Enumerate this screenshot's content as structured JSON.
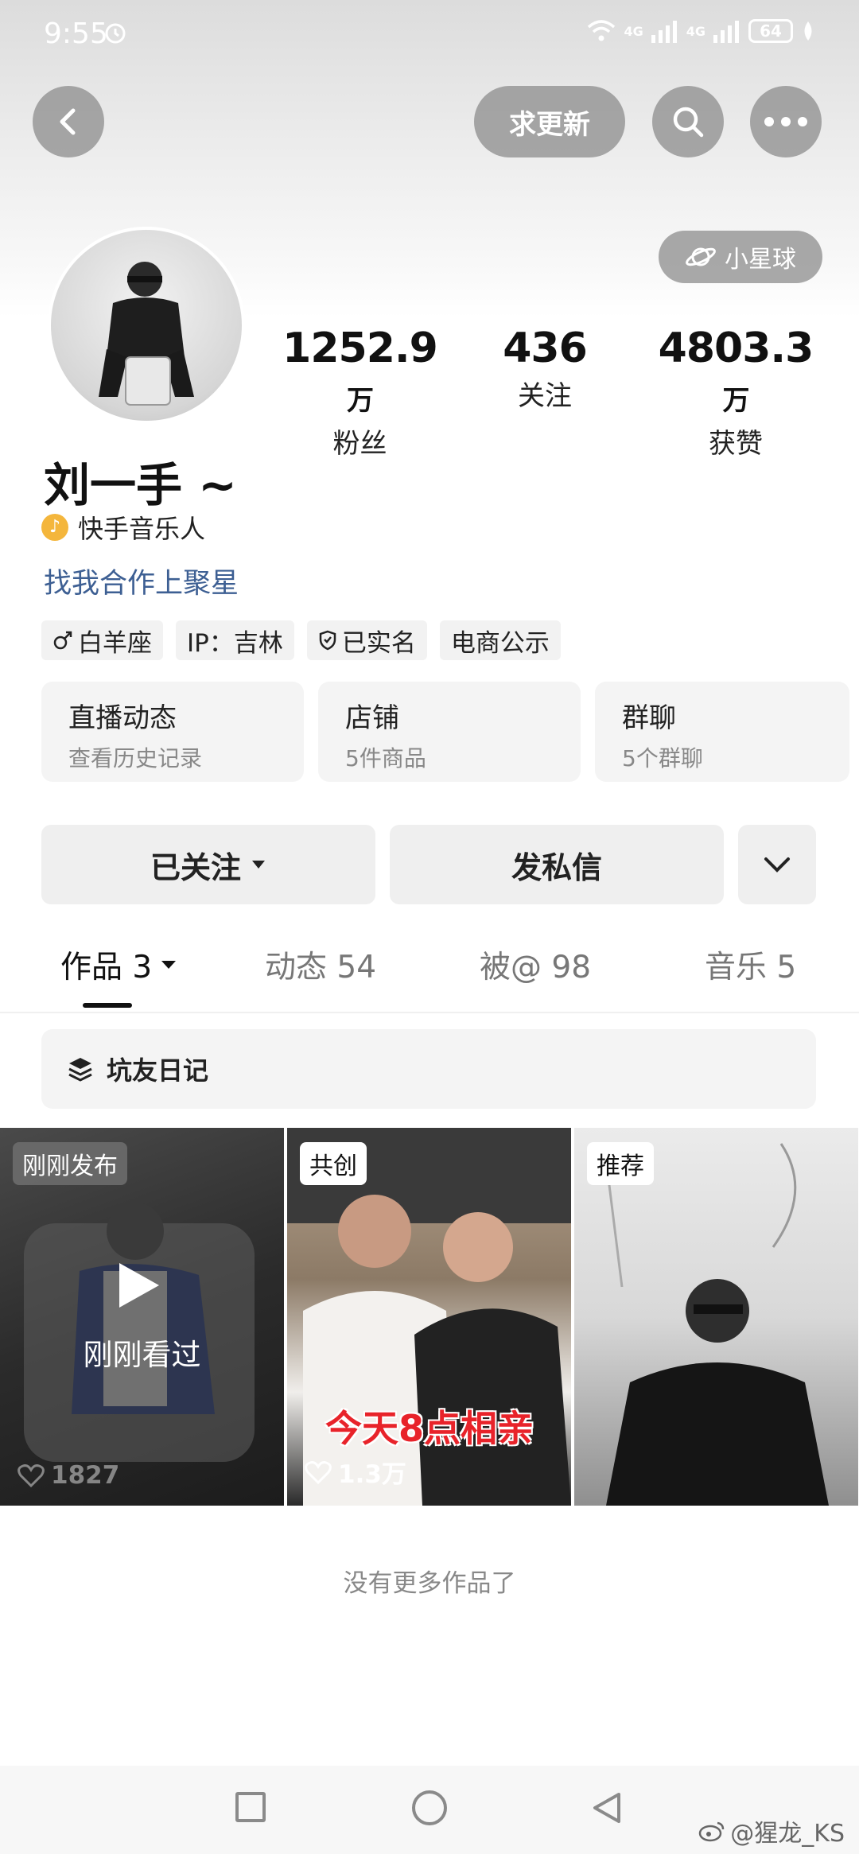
{
  "status_bar": {
    "time": "9:55",
    "network_1": "4G",
    "network_2": "4G",
    "battery": "64"
  },
  "header": {
    "request_update": "求更新"
  },
  "planet_button": {
    "label": "小星球"
  },
  "stats": [
    {
      "num": "1252.9",
      "unit": "万",
      "label": "粉丝"
    },
    {
      "num": "436",
      "unit": "",
      "label": "关注"
    },
    {
      "num": "4803.3",
      "unit": "万",
      "label": "获赞"
    }
  ],
  "profile": {
    "name": "刘一手 ~",
    "verification": "快手音乐人",
    "cooperation_link": "找我合作上聚星"
  },
  "tags": [
    "白羊座",
    "IP：吉林",
    "已实名",
    "电商公示"
  ],
  "cards": [
    {
      "title": "直播动态",
      "sub": "查看历史记录"
    },
    {
      "title": "店铺",
      "sub": "5件商品"
    },
    {
      "title": "群聊",
      "sub": "5个群聊"
    }
  ],
  "actions": {
    "follow": "已关注",
    "message": "发私信"
  },
  "tabs": [
    {
      "label": "作品 3"
    },
    {
      "label": "动态 54"
    },
    {
      "label": "被@ 98"
    },
    {
      "label": "音乐 5"
    }
  ],
  "collection": {
    "label": "坑友日记"
  },
  "videos": [
    {
      "badge": "刚刚发布",
      "overlay": "刚刚看过",
      "likes": "1827"
    },
    {
      "badge": "共创",
      "overlay": "今天8点相亲",
      "likes": "1.3万"
    },
    {
      "badge": "推荐",
      "overlay": "",
      "likes": ""
    }
  ],
  "footer": {
    "no_more": "没有更多作品了"
  },
  "watermark": {
    "text": "@猩龙_KS"
  }
}
